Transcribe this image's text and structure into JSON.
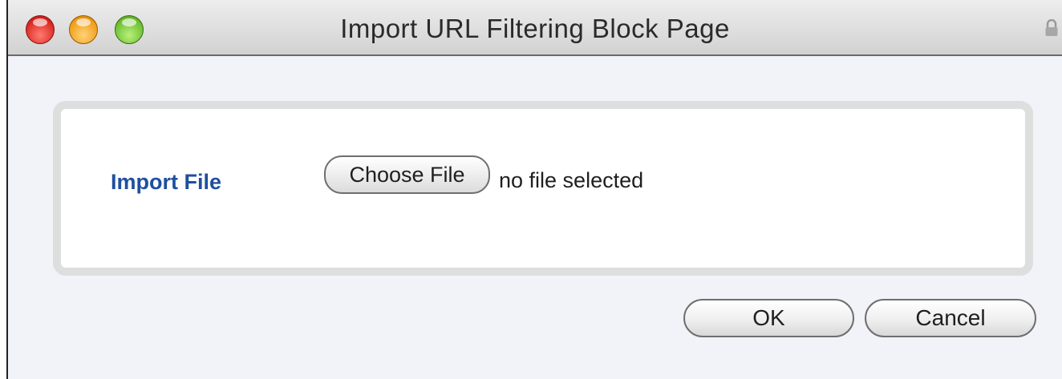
{
  "window": {
    "title": "Import URL Filtering Block Page"
  },
  "titlebar_icons": {
    "close": "close-traffic-light-icon",
    "minimize": "minimize-traffic-light-icon",
    "zoom": "zoom-traffic-light-icon",
    "lock": "lock-icon"
  },
  "form": {
    "import_label": "Import File",
    "choose_button": "Choose File",
    "file_status": "no file selected"
  },
  "footer": {
    "ok_label": "OK",
    "cancel_label": "Cancel"
  },
  "colors": {
    "label_blue": "#1f4fa0",
    "window_bg": "#f1f3f8"
  }
}
